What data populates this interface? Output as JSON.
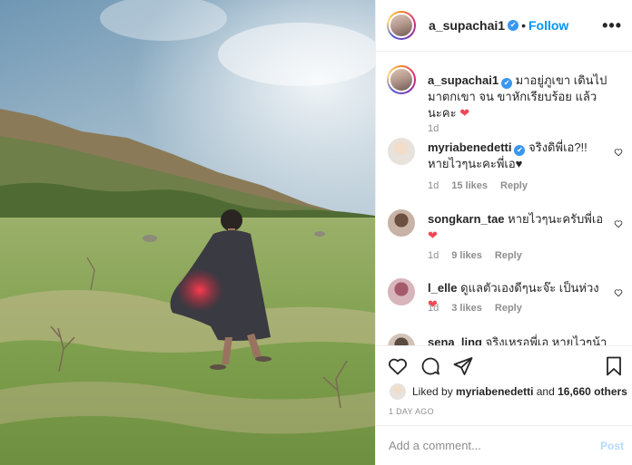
{
  "header": {
    "username": "a_supachai1",
    "dot": "•",
    "follow_label": "Follow",
    "more_icon": "more-horizontal-icon"
  },
  "caption": {
    "username": "a_supachai1",
    "text": "มาอยู่ภูเขา เดินไปมาตกเขา จน ขาหักเรียบร้อย แล้วนะคะ",
    "emoji": "❤",
    "time": "1d"
  },
  "comments": [
    {
      "username": "myriabenedetti",
      "verified": true,
      "text": "จริงดิพี่เอ?!! หายไวๆนะคะพี่เอ♥",
      "time": "1d",
      "likes": "15 likes",
      "reply": "Reply"
    },
    {
      "username": "songkarn_tae",
      "verified": false,
      "text": "หายไวๆนะครับพี่เอ",
      "emoji": "❤",
      "time": "1d",
      "likes": "9 likes",
      "reply": "Reply"
    },
    {
      "username": "l_elle",
      "verified": false,
      "text": "ดูแลตัวเองดีๆนะจ๊ะ เป็นห่วง",
      "emoji": "❤",
      "time": "1d",
      "likes": "3 likes",
      "reply": "Reply"
    },
    {
      "username": "sena_ling",
      "verified": false,
      "text": "จริงเหรอพี่เอ หายไวๆน้า"
    }
  ],
  "actions": {
    "icons": [
      "heart-icon",
      "comment-icon",
      "share-icon",
      "bookmark-icon"
    ]
  },
  "likes": {
    "prefix": "Liked by",
    "user": "myriabenedetti",
    "and": "and",
    "others": "16,660 others"
  },
  "date": "1 DAY AGO",
  "add_comment": {
    "placeholder": "Add a comment...",
    "post_label": "Post"
  },
  "colors": {
    "follow": "#0095f6",
    "verified": "#3897f0",
    "heart": "#ed4956",
    "post_disabled": "#b3dbff"
  }
}
